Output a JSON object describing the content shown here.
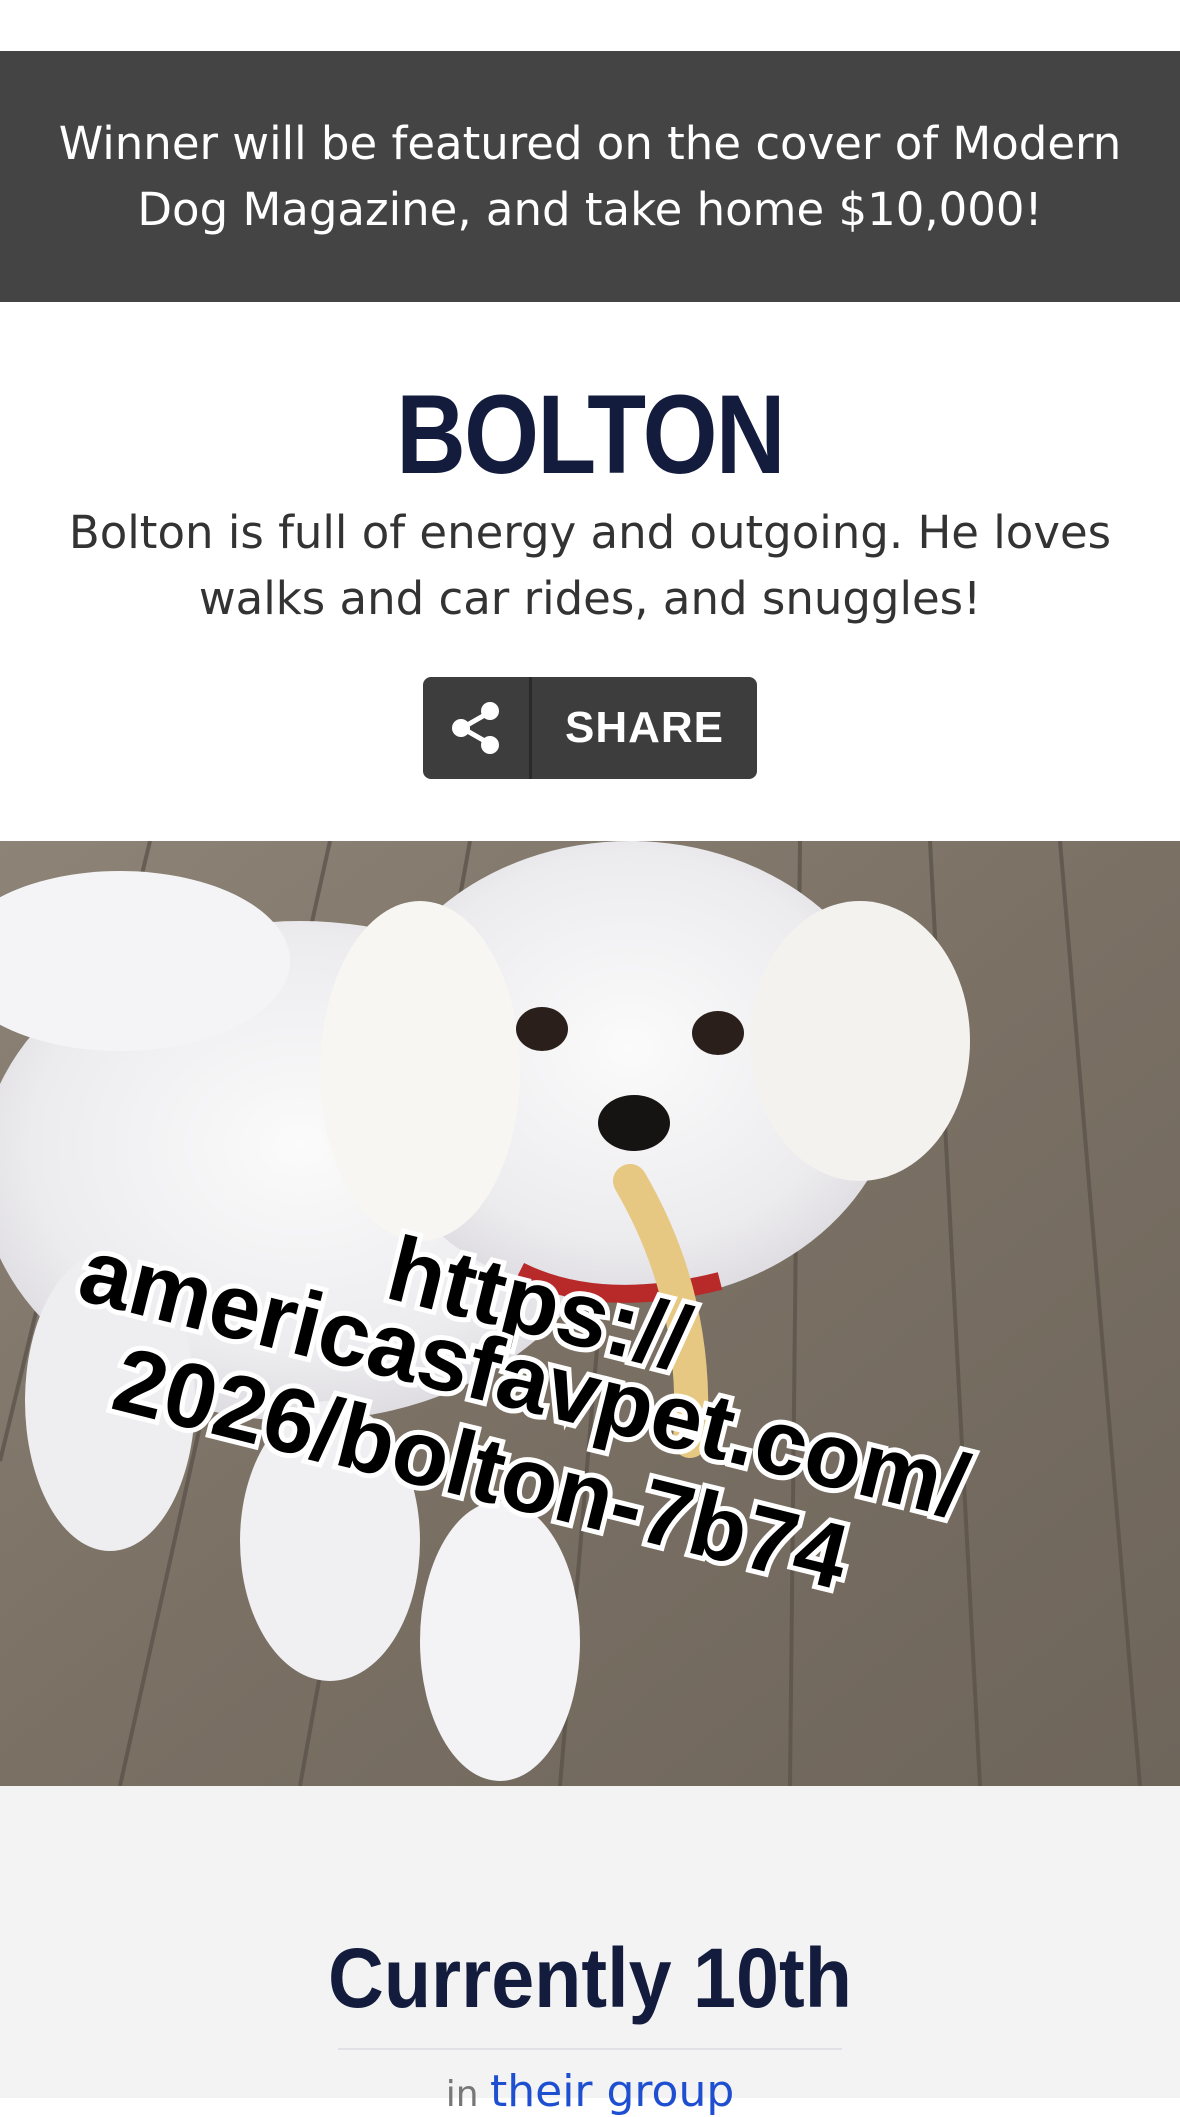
{
  "banner": {
    "text": "Winner will be featured on the cover of Modern Dog Magazine, and take home $10,000!"
  },
  "pet": {
    "name": "BOLTON",
    "description": "Bolton is full of energy and outgoing. He loves walks and car rides, and snuggles!",
    "photo_overlay_lines": [
      "https://",
      "americasfavpet.com/",
      "2026/bolton-7b74"
    ]
  },
  "share": {
    "label": "SHARE",
    "icon": "share-icon"
  },
  "ranking": {
    "title": "Currently 10th",
    "sub_prefix": "in",
    "sub_link": "their group"
  },
  "colors": {
    "banner_bg": "#444444",
    "name_color": "#131c3d",
    "share_bg": "#3d3d3d",
    "link": "#1f4fd1"
  }
}
